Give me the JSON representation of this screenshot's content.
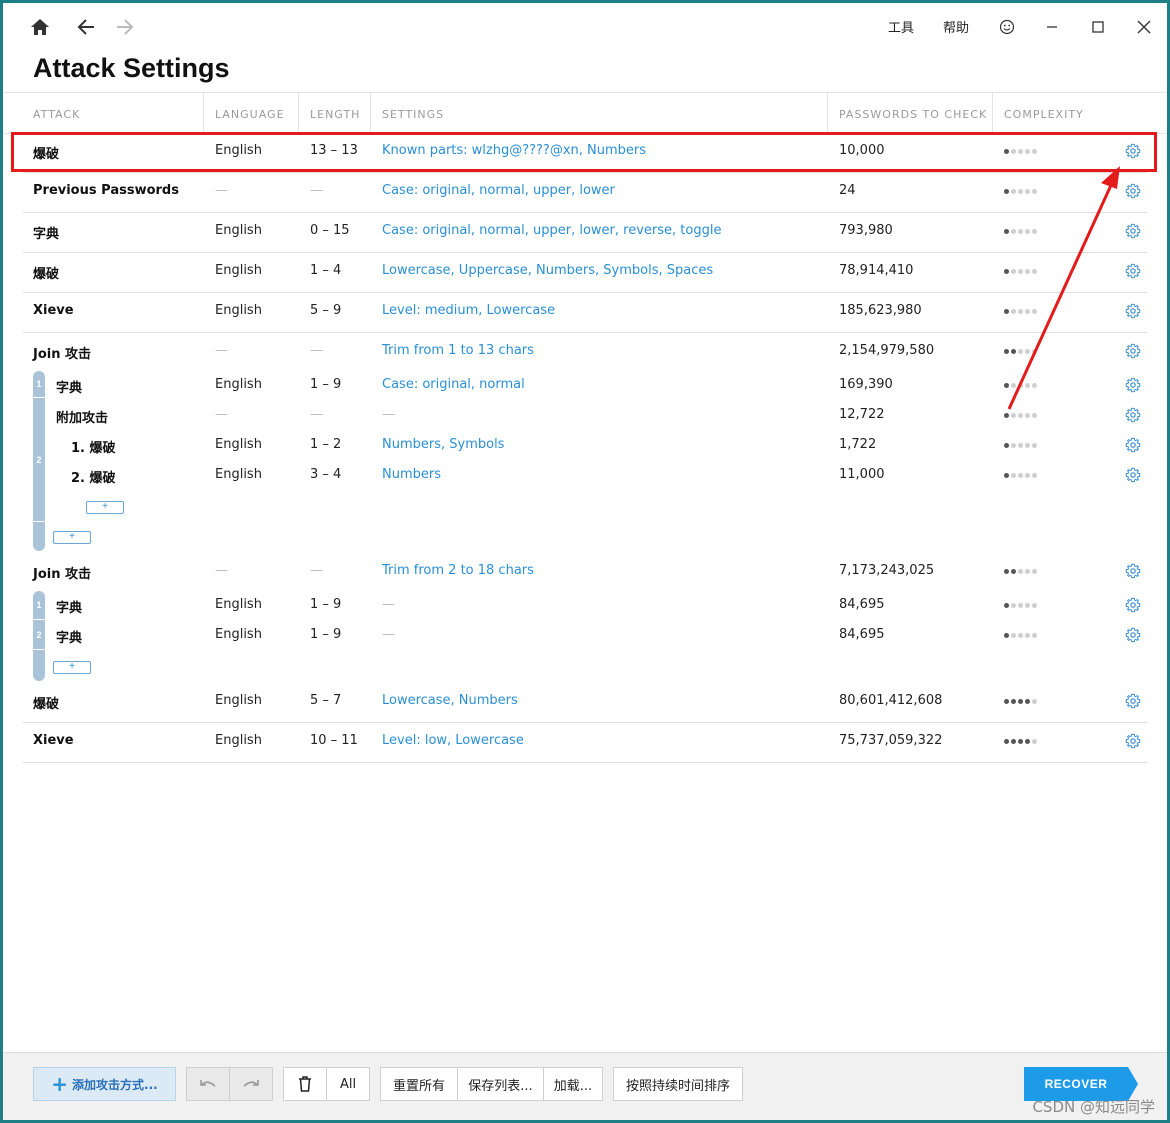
{
  "titlebar": {
    "tools": "工具",
    "help": "帮助"
  },
  "page_title": "Attack Settings",
  "columns": [
    "ATTACK",
    "LANGUAGE",
    "LENGTH",
    "SETTINGS",
    "PASSWORDS TO CHECK",
    "COMPLEXITY"
  ],
  "rows": [
    {
      "attack": "爆破",
      "language": "English",
      "length": "13 – 13",
      "settings": "Known parts: wlzhg@????@xn, Numbers",
      "passwords": "10,000",
      "complexity": 1
    },
    {
      "attack": "Previous Passwords",
      "language": "—",
      "length": "—",
      "settings": "Case: original, normal, upper, lower",
      "passwords": "24",
      "complexity": 1
    },
    {
      "attack": "字典",
      "language": "English",
      "length": "0 – 15",
      "settings": "Case: original, normal, upper, lower, reverse, toggle",
      "passwords": "793,980",
      "complexity": 1
    },
    {
      "attack": "爆破",
      "language": "English",
      "length": "1 – 4",
      "settings": "Lowercase, Uppercase, Numbers, Symbols, Spaces",
      "passwords": "78,914,410",
      "complexity": 1
    },
    {
      "attack": "Xieve",
      "language": "English",
      "length": "5 – 9",
      "settings": "Level: medium, Lowercase",
      "passwords": "185,623,980",
      "complexity": 1
    },
    {
      "attack": "Join 攻击",
      "language": "—",
      "length": "—",
      "settings": "Trim from 1 to 13 chars",
      "passwords": "2,154,979,580",
      "complexity": 2
    },
    {
      "attack": "字典",
      "language": "English",
      "length": "1 – 9",
      "settings": "Case: original, normal",
      "passwords": "169,390",
      "complexity": 1
    },
    {
      "attack": "附加攻击",
      "language": "—",
      "length": "—",
      "settings": "—",
      "passwords": "12,722",
      "complexity": 1
    },
    {
      "attack": "1. 爆破",
      "language": "English",
      "length": "1 – 2",
      "settings": "Numbers, Symbols",
      "passwords": "1,722",
      "complexity": 1
    },
    {
      "attack": "2. 爆破",
      "language": "English",
      "length": "3 – 4",
      "settings": "Numbers",
      "passwords": "11,000",
      "complexity": 1
    },
    {
      "attack": "Join 攻击",
      "language": "—",
      "length": "—",
      "settings": "Trim from 2 to 18 chars",
      "passwords": "7,173,243,025",
      "complexity": 2
    },
    {
      "attack": "字典",
      "language": "English",
      "length": "1 – 9",
      "settings": "—",
      "passwords": "84,695",
      "complexity": 1
    },
    {
      "attack": "字典",
      "language": "English",
      "length": "1 – 9",
      "settings": "—",
      "passwords": "84,695",
      "complexity": 1
    },
    {
      "attack": "爆破",
      "language": "English",
      "length": "5 – 7",
      "settings": "Lowercase, Numbers",
      "passwords": "80,601,412,608",
      "complexity": 4
    },
    {
      "attack": "Xieve",
      "language": "English",
      "length": "10 – 11",
      "settings": "Level: low, Lowercase",
      "passwords": "75,737,059,322",
      "complexity": 4
    }
  ],
  "group_numbers": [
    "1",
    "2",
    "1",
    "2"
  ],
  "plus_label": "+",
  "footer": {
    "add_attack": "添加攻击方式...",
    "all": "All",
    "reset_all": "重置所有",
    "save_list": "保存列表...",
    "load": "加载...",
    "sort_by_duration": "按照持续时间排序",
    "recover": "RECOVER"
  },
  "watermark": "CSDN @知远同学",
  "colors": {
    "accent": "#1e9be8",
    "link": "#2a8fd4",
    "annotation": "#e31b1b",
    "group_bar": "#a9c4d8"
  }
}
